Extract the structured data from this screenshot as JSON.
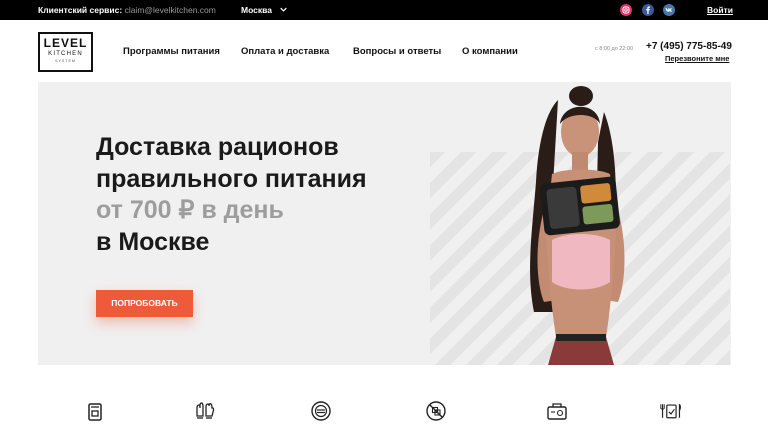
{
  "topbar": {
    "service_label": "Клиентский сервис:",
    "service_email": "claim@levelkitchen.com",
    "city": "Москва",
    "login": "Войти",
    "social": [
      {
        "icon": "instagram-icon",
        "color": "#e1306c"
      },
      {
        "icon": "facebook-icon",
        "color": "#3b5998"
      },
      {
        "icon": "vk-icon",
        "color": "#4a76a8"
      }
    ]
  },
  "header": {
    "logo": {
      "line1": "LEVEL",
      "line2": "KITCHEN",
      "line3": "SYSTEM"
    },
    "nav": [
      "Программы питания",
      "Оплата и доставка",
      "Вопросы и ответы",
      "О компании"
    ],
    "hours": "с 8:00 до 22:00",
    "phone": "+7 (495) 775-85-49",
    "callback": "Перезвоните мне"
  },
  "hero": {
    "line1": "Доставка рационов",
    "line2": "правильного питания",
    "line3": "от 700 ₽ в день",
    "line4": "в Москве",
    "cta": "ПОПРОБОВАТЬ",
    "accent": "#ee5a3a"
  },
  "features": [
    {
      "icon": "bag-icon"
    },
    {
      "icon": "gloves-icon"
    },
    {
      "icon": "plate-icon"
    },
    {
      "icon": "no-sugar-icon"
    },
    {
      "icon": "delivery-box-icon"
    },
    {
      "icon": "cutlery-check-icon"
    }
  ]
}
